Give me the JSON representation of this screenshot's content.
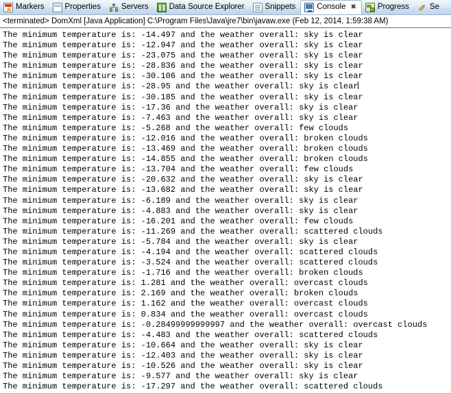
{
  "tabbar": {
    "tabs": [
      {
        "label": "Markers",
        "icon": "markers-icon",
        "active": false,
        "closable": false
      },
      {
        "label": "Properties",
        "icon": "properties-icon",
        "active": false,
        "closable": false
      },
      {
        "label": "Servers",
        "icon": "servers-icon",
        "active": false,
        "closable": false
      },
      {
        "label": "Data Source Explorer",
        "icon": "data-source-explorer-icon",
        "active": false,
        "closable": false
      },
      {
        "label": "Snippets",
        "icon": "snippets-icon",
        "active": false,
        "closable": false
      },
      {
        "label": "Console",
        "icon": "console-icon",
        "active": true,
        "closable": true
      },
      {
        "label": "Progress",
        "icon": "progress-icon",
        "active": false,
        "closable": false
      },
      {
        "label": "Se",
        "icon": "search-icon",
        "active": false,
        "closable": false
      }
    ],
    "close_glyph": "✖"
  },
  "console": {
    "header": "<terminated> DomXml [Java Application] C:\\Program Files\\Java\\jre7\\bin\\javaw.exe (Feb 12, 2014, 1:59:38 AM)",
    "caret_line_index": 5,
    "lines": [
      "The minimum temperature is: -14.497 and the weather overall: sky is clear",
      "The minimum temperature is: -12.947 and the weather overall: sky is clear",
      "The minimum temperature is: -23.075 and the weather overall: sky is clear",
      "The minimum temperature is: -28.836 and the weather overall: sky is clear",
      "The minimum temperature is: -30.106 and the weather overall: sky is clear",
      "The minimum temperature is: -28.95 and the weather overall: sky is clear",
      "The minimum temperature is: -30.185 and the weather overall: sky is clear",
      "The minimum temperature is: -17.36 and the weather overall: sky is clear",
      "The minimum temperature is: -7.463 and the weather overall: sky is clear",
      "The minimum temperature is: -5.268 and the weather overall: few clouds",
      "The minimum temperature is: -12.016 and the weather overall: broken clouds",
      "The minimum temperature is: -13.469 and the weather overall: broken clouds",
      "The minimum temperature is: -14.855 and the weather overall: broken clouds",
      "The minimum temperature is: -13.704 and the weather overall: few clouds",
      "The minimum temperature is: -20.632 and the weather overall: sky is clear",
      "The minimum temperature is: -13.682 and the weather overall: sky is clear",
      "The minimum temperature is: -6.189 and the weather overall: sky is clear",
      "The minimum temperature is: -4.883 and the weather overall: sky is clear",
      "The minimum temperature is: -16.201 and the weather overall: few clouds",
      "The minimum temperature is: -11.269 and the weather overall: scattered clouds",
      "The minimum temperature is: -5.784 and the weather overall: sky is clear",
      "The minimum temperature is: -4.194 and the weather overall: scattered clouds",
      "The minimum temperature is: -3.524 and the weather overall: scattered clouds",
      "The minimum temperature is: -1.716 and the weather overall: broken clouds",
      "The minimum temperature is: 1.281 and the weather overall: overcast clouds",
      "The minimum temperature is: 2.169 and the weather overall: broken clouds",
      "The minimum temperature is: 1.162 and the weather overall: overcast clouds",
      "The minimum temperature is: 0.834 and the weather overall: overcast clouds",
      "The minimum temperature is: -0.28499999999997 and the weather overall: overcast clouds",
      "The minimum temperature is: -4.483 and the weather overall: scattered clouds",
      "The minimum temperature is: -10.664 and the weather overall: sky is clear",
      "The minimum temperature is: -12.403 and the weather overall: sky is clear",
      "The minimum temperature is: -10.526 and the weather overall: sky is clear",
      "The minimum temperature is: -9.577 and the weather overall: sky is clear",
      "The minimum temperature is: -17.297 and the weather overall: scattered clouds"
    ]
  },
  "colors": {
    "tabbar_top": "#f2f6fb",
    "tabbar_bottom": "#bed6ef",
    "active_tab_bg": "#ffffff",
    "border": "#9cb3cc",
    "separator": "#6e6e6e",
    "text": "#000000",
    "console_bg": "#ffffff"
  }
}
